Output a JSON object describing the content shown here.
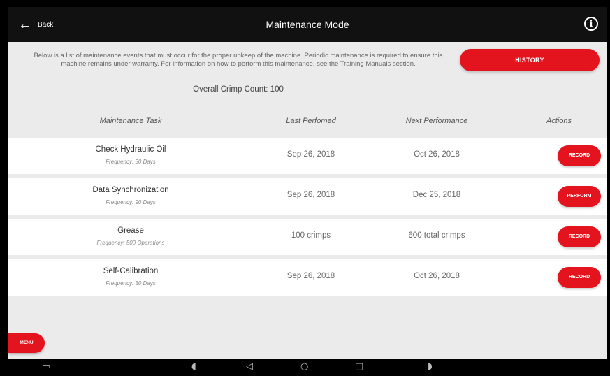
{
  "header": {
    "back_label": "Back",
    "title": "Maintenance Mode"
  },
  "intro": {
    "description": "Below is a list of maintenance events that must occur for the proper upkeep of the machine. Periodic maintenance is required to ensure this machine remains under warranty. For information on how to perform this maintenance, see the Training Manuals section.",
    "crimp_count": "Overall Crimp Count: 100",
    "history_label": "HISTORY"
  },
  "table": {
    "columns": [
      "Maintenance Task",
      "Last Perfomed",
      "Next Performance",
      "Actions"
    ],
    "rows": [
      {
        "task": "Check Hydraulic Oil",
        "frequency": "Frequency: 30 Days",
        "last": "Sep 26, 2018",
        "next": "Oct 26, 2018",
        "action": "RECORD"
      },
      {
        "task": "Data Synchronization",
        "frequency": "Frequency: 90 Days",
        "last": "Sep 26, 2018",
        "next": "Dec 25, 2018",
        "action": "PERFORM"
      },
      {
        "task": "Grease",
        "frequency": "Frequency: 500 Operations",
        "last": "100 crimps",
        "next": "600 total crimps",
        "action": "RECORD"
      },
      {
        "task": "Self-Calibration",
        "frequency": "Frequency: 30 Days",
        "last": "Sep 26, 2018",
        "next": "Oct 26, 2018",
        "action": "RECORD"
      }
    ]
  },
  "menu_label": "MENU",
  "colors": {
    "accent": "#e3141e",
    "topbar": "#111111",
    "background": "#ebebeb"
  },
  "icons": [
    "back-arrow-icon",
    "info-icon",
    "screenshot-icon",
    "volume-down-icon",
    "nav-back-icon",
    "nav-home-icon",
    "nav-recents-icon",
    "volume-up-icon"
  ]
}
